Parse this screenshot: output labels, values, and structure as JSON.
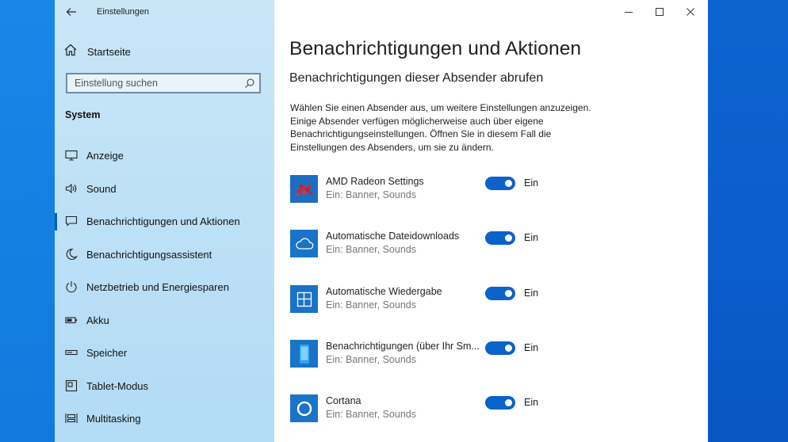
{
  "window": {
    "title": "Einstellungen",
    "minimize_icon": "minimize-icon",
    "maximize_icon": "maximize-icon",
    "close_icon": "close-icon"
  },
  "sidebar": {
    "home_label": "Startseite",
    "search_placeholder": "Einstellung suchen",
    "section": "System",
    "items": [
      {
        "label": "Anzeige",
        "icon": "display-icon"
      },
      {
        "label": "Sound",
        "icon": "speaker-icon"
      },
      {
        "label": "Benachrichtigungen und Aktionen",
        "icon": "message-icon",
        "selected": true
      },
      {
        "label": "Benachrichtigungsassistent",
        "icon": "moon-icon"
      },
      {
        "label": "Netzbetrieb und Energiesparen",
        "icon": "power-icon"
      },
      {
        "label": "Akku",
        "icon": "battery-icon"
      },
      {
        "label": "Speicher",
        "icon": "storage-icon"
      },
      {
        "label": "Tablet-Modus",
        "icon": "tablet-icon"
      },
      {
        "label": "Multitasking",
        "icon": "multitasking-icon"
      }
    ]
  },
  "main": {
    "title": "Benachrichtigungen und Aktionen",
    "subtitle": "Benachrichtigungen dieser Absender abrufen",
    "description": "Wählen Sie einen Absender aus, um weitere Einstellungen anzuzeigen. Einige Absender verfügen möglicherweise auch über eigene Benachrichtigungseinstellungen. Öffnen Sie in diesem Fall die Einstellungen des Absenders, um sie zu ändern.",
    "senders": [
      {
        "name": "AMD Radeon Settings",
        "detail": "Ein: Banner, Sounds",
        "state": "Ein",
        "on": true,
        "icon": "amd-radeon-icon"
      },
      {
        "name": "Automatische Dateidownloads",
        "detail": "Ein: Banner, Sounds",
        "state": "Ein",
        "on": true,
        "icon": "cloud-icon"
      },
      {
        "name": "Automatische Wiedergabe",
        "detail": "Ein: Banner, Sounds",
        "state": "Ein",
        "on": true,
        "icon": "autoplay-icon"
      },
      {
        "name": "Benachrichtigungen (über Ihr Sm...",
        "detail": "Ein: Banner, Sounds",
        "state": "Ein",
        "on": true,
        "icon": "phone-icon"
      },
      {
        "name": "Cortana",
        "detail": "Ein: Banner, Sounds",
        "state": "Ein",
        "on": true,
        "icon": "cortana-icon"
      }
    ]
  },
  "colors": {
    "accent": "#0a63c8",
    "sidebar_bg": "#c0e1f6",
    "tile_bg": "#1a73c9"
  }
}
